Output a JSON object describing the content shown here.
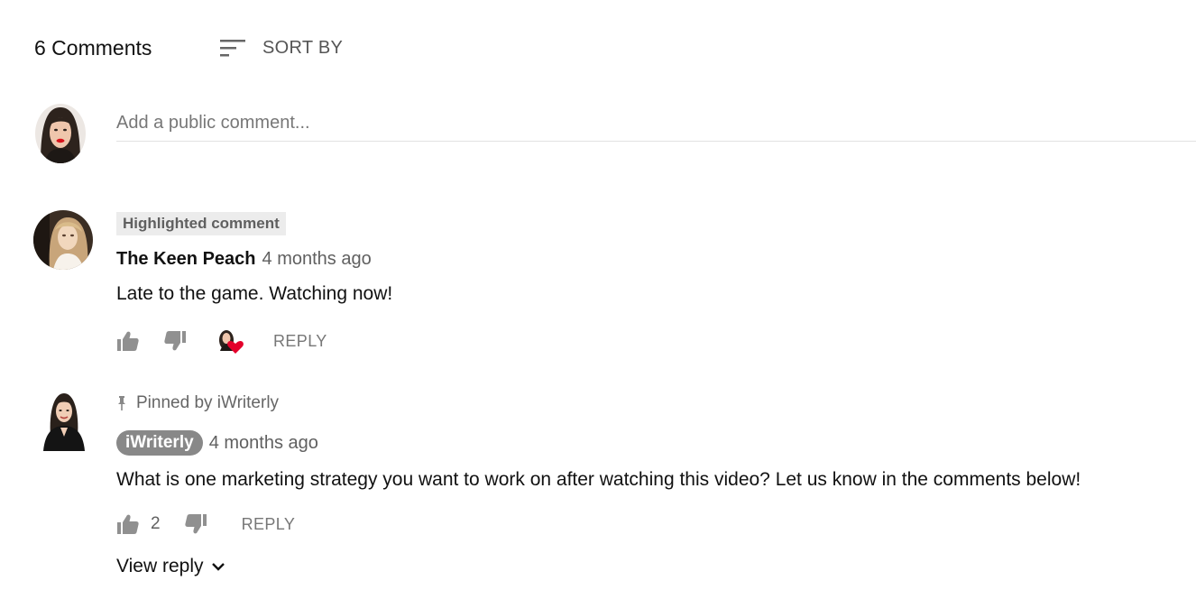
{
  "header": {
    "comment_count": "6 Comments",
    "sort_label": "SORT BY",
    "sort_icon": "sort-icon"
  },
  "composer": {
    "avatar": "user-avatar",
    "placeholder": "Add a public comment..."
  },
  "comments": [
    {
      "badge": "Highlighted comment",
      "author": "The Keen Peach",
      "timestamp": "4 months ago",
      "text": "Late to the game. Watching now!",
      "like_count": "",
      "creator_heart": true,
      "reply_label": "REPLY"
    },
    {
      "pinned_label": "Pinned by iWriterly",
      "author": "iWriterly",
      "author_is_creator": true,
      "timestamp": "4 months ago",
      "text": "What is one marketing strategy you want to work on after watching this video? Let us know in the comments below!",
      "like_count": "2",
      "reply_label": "REPLY",
      "view_reply_label": "View reply"
    }
  ],
  "colors": {
    "heart": "#e4002b",
    "creator_chip": "#888888",
    "highlight_badge_bg": "#ececec"
  }
}
